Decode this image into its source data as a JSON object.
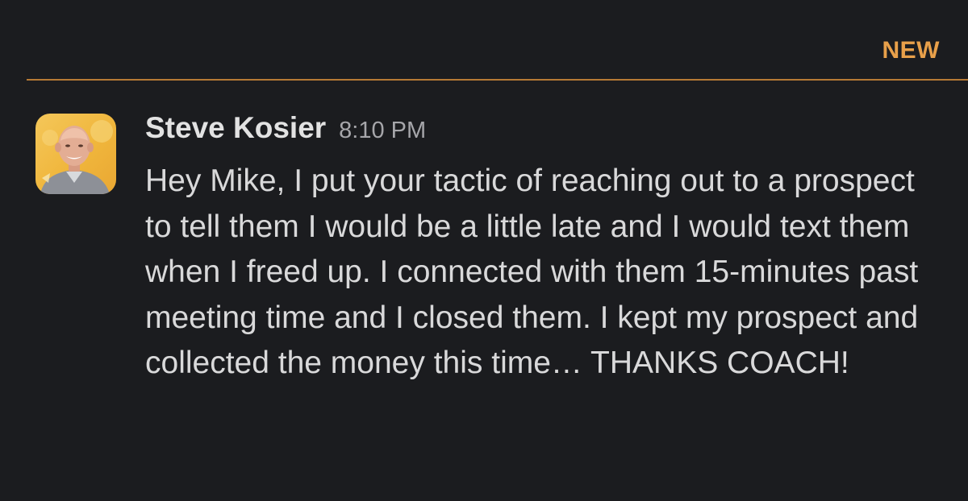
{
  "divider": {
    "label": "NEW",
    "accent_color": "#e8a04a"
  },
  "message": {
    "sender": "Steve Kosier",
    "timestamp": "8:10 PM",
    "avatar_icon": "user-photo-avatar",
    "text": "Hey Mike, I put your tactic of reaching out to a prospect to tell them I would be a little late and I would text them when I freed up. I connected with them 15-minutes past meeting time and I closed them. I kept my prospect and collected the money this time… THANKS COACH!"
  }
}
